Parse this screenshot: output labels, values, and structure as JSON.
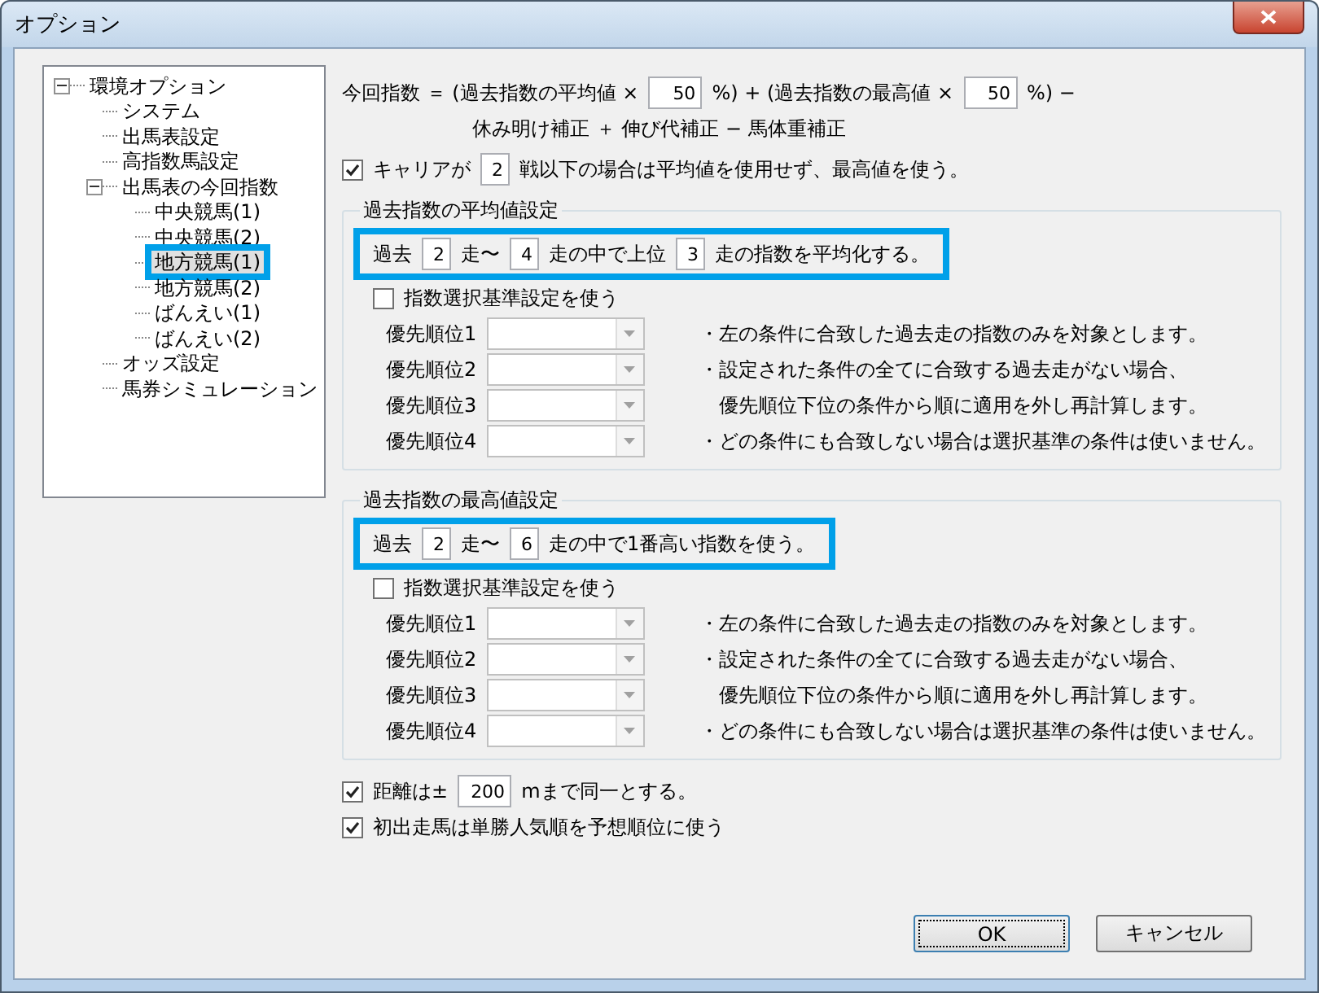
{
  "window": {
    "title": "オプション"
  },
  "tree": [
    {
      "label": "環境オプション",
      "selected": false,
      "highlighted": false,
      "expanded": true,
      "children": [
        {
          "label": "システム",
          "selected": false,
          "highlighted": false
        },
        {
          "label": "出馬表設定",
          "selected": false,
          "highlighted": false
        },
        {
          "label": "高指数馬設定",
          "selected": false,
          "highlighted": false
        },
        {
          "label": "出馬表の今回指数",
          "selected": false,
          "highlighted": false,
          "expanded": true,
          "children": [
            {
              "label": "中央競馬(1)",
              "selected": false,
              "highlighted": false
            },
            {
              "label": "中央競馬(2)",
              "selected": false,
              "highlighted": false
            },
            {
              "label": "地方競馬(1)",
              "selected": true,
              "highlighted": true
            },
            {
              "label": "地方競馬(2)",
              "selected": false,
              "highlighted": false
            },
            {
              "label": "ばんえい(1)",
              "selected": false,
              "highlighted": false
            },
            {
              "label": "ばんえい(2)",
              "selected": false,
              "highlighted": false
            }
          ]
        },
        {
          "label": "オッズ設定",
          "selected": false,
          "highlighted": false
        },
        {
          "label": "馬券シミュレーション",
          "selected": false,
          "highlighted": false
        }
      ]
    }
  ],
  "formula": {
    "line_1": [
      {
        "kind": "text",
        "text": "今回指数 ＝ (過去指数の平均値 ×"
      },
      {
        "kind": "field",
        "value": "50"
      },
      {
        "kind": "text",
        "text": "%) + (過去指数の最高値 ×"
      },
      {
        "kind": "field",
        "value": "50"
      },
      {
        "kind": "text",
        "text": "%) −"
      }
    ],
    "line_2": "休み明け補正 ＋ 伸び代補正 − 馬体重補正"
  },
  "career": {
    "checked": true,
    "parts": [
      {
        "kind": "text",
        "text": "キャリアが"
      },
      {
        "kind": "field",
        "value": "2"
      },
      {
        "kind": "text",
        "text": "戦以下の場合は平均値を使用せず、最高値を使う。"
      }
    ]
  },
  "groups": [
    {
      "title": "過去指数の平均値設定",
      "highlighted": true,
      "parts": [
        {
          "kind": "text",
          "text": "過去"
        },
        {
          "kind": "field",
          "value": "2"
        },
        {
          "kind": "text",
          "text": "走〜"
        },
        {
          "kind": "field",
          "value": "4"
        },
        {
          "kind": "text",
          "text": "走の中で上位"
        },
        {
          "kind": "field",
          "value": "3"
        },
        {
          "kind": "text",
          "text": "走の指数を平均化する。"
        }
      ],
      "use_criteria": {
        "label": "指数選択基準設定を使う",
        "checked": false
      },
      "priorities": [
        {
          "label": "優先順位1",
          "disabled": true
        },
        {
          "label": "優先順位2",
          "disabled": true
        },
        {
          "label": "優先順位3",
          "disabled": true
        },
        {
          "label": "優先順位4",
          "disabled": true
        }
      ],
      "notes": [
        "・左の条件に合致した過去走の指数のみを対象とします。",
        "・設定された条件の全てに合致する過去走がない場合、",
        "　優先順位下位の条件から順に適用を外し再計算します。",
        "・どの条件にも合致しない場合は選択基準の条件は使いません。"
      ]
    },
    {
      "title": "過去指数の最高値設定",
      "highlighted": true,
      "parts": [
        {
          "kind": "text",
          "text": "過去"
        },
        {
          "kind": "field",
          "value": "2"
        },
        {
          "kind": "text",
          "text": "走〜"
        },
        {
          "kind": "field",
          "value": "6"
        },
        {
          "kind": "text",
          "text": "走の中で1番高い指数を使う。"
        }
      ],
      "use_criteria": {
        "label": "指数選択基準設定を使う",
        "checked": false
      },
      "priorities": [
        {
          "label": "優先順位1",
          "disabled": true
        },
        {
          "label": "優先順位2",
          "disabled": true
        },
        {
          "label": "優先順位3",
          "disabled": true
        },
        {
          "label": "優先順位4",
          "disabled": true
        }
      ],
      "notes": [
        "・左の条件に合致した過去走の指数のみを対象とします。",
        "・設定された条件の全てに合致する過去走がない場合、",
        "　優先順位下位の条件から順に適用を外し再計算します。",
        "・どの条件にも合致しない場合は選択基準の条件は使いません。"
      ]
    }
  ],
  "options": [
    {
      "checked": true,
      "parts": [
        {
          "kind": "text",
          "text": "距離は±"
        },
        {
          "kind": "field",
          "value": "200"
        },
        {
          "kind": "text",
          "text": "mまで同一とする。"
        }
      ]
    },
    {
      "checked": true,
      "parts": [
        {
          "kind": "text",
          "text": "初出走馬は単勝人気順を予想順位に使う"
        }
      ]
    }
  ],
  "buttons": [
    {
      "label": "OK",
      "default": true
    },
    {
      "label": "キャンセル",
      "default": false
    }
  ]
}
